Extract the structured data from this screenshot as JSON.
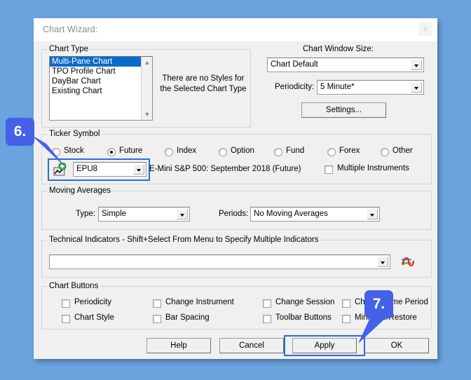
{
  "window": {
    "title": "Chart Wizard:",
    "close_label": "x"
  },
  "chart_type": {
    "group_label": "Chart Type",
    "items": [
      {
        "label": "Multi-Pane Chart",
        "selected": true
      },
      {
        "label": "TPO Profile Chart",
        "selected": false
      },
      {
        "label": "DayBar Chart",
        "selected": false
      },
      {
        "label": "Existing Chart",
        "selected": false
      }
    ],
    "styles_note_line1": "There are no Styles for",
    "styles_note_line2": "the Selected Chart Type"
  },
  "chart_window": {
    "size_label": "Chart Window Size:",
    "size_value": "Chart Default",
    "periodicity_label": "Periodicity:",
    "periodicity_value": "5 Minute*",
    "settings_button": "Settings..."
  },
  "ticker_symbol": {
    "group_label": "Ticker Symbol",
    "types": [
      {
        "label": "Stock",
        "selected": false
      },
      {
        "label": "Future",
        "selected": true
      },
      {
        "label": "Index",
        "selected": false
      },
      {
        "label": "Option",
        "selected": false
      },
      {
        "label": "Fund",
        "selected": false
      },
      {
        "label": "Forex",
        "selected": false
      },
      {
        "label": "Other",
        "selected": false
      }
    ],
    "symbol_value": "EPU8",
    "symbol_description": "E-Mini S&P 500: September 2018 (Future)",
    "multiple_instruments_label": "Multiple Instruments",
    "multiple_instruments_checked": false,
    "icon": "add-chart-icon"
  },
  "moving_averages": {
    "group_label": "Moving Averages",
    "type_label": "Type:",
    "type_value": "Simple",
    "periods_label": "Periods:",
    "periods_value": "No Moving Averages"
  },
  "technical_indicators": {
    "group_label": "Technical Indicators  - Shift+Select From Menu to Specify Multiple Indicators",
    "value": "",
    "icon": "indicator-wave-icon"
  },
  "chart_buttons": {
    "group_label": "Chart Buttons",
    "items": [
      {
        "label": "Periodicity",
        "checked": false
      },
      {
        "label": "Change Instrument",
        "checked": false
      },
      {
        "label": "Change Session",
        "checked": false
      },
      {
        "label": "Change Time Period",
        "checked": false
      },
      {
        "label": "Chart Style",
        "checked": false
      },
      {
        "label": "Bar Spacing",
        "checked": false
      },
      {
        "label": "Toolbar Buttons",
        "checked": false
      },
      {
        "label": "Minimize/Restore",
        "checked": false
      }
    ]
  },
  "footer": {
    "help": "Help",
    "cancel": "Cancel",
    "apply": "Apply",
    "ok": "OK"
  },
  "callouts": [
    {
      "label": "6."
    },
    {
      "label": "7."
    }
  ],
  "colors": {
    "desktop_background": "#6aa3de",
    "dialog_background": "#f0f0f0",
    "selection_blue": "#0a6bce",
    "highlight_ring": "#2d6bdd",
    "callout_blue": "#4461e8"
  }
}
